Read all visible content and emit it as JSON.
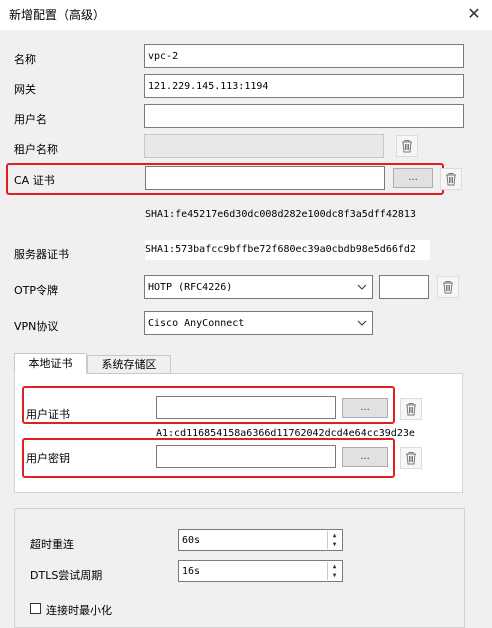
{
  "window": {
    "title": "新增配置（高级）",
    "close_label": "✕"
  },
  "form": {
    "name": {
      "label": "名称",
      "value": "vpc-2"
    },
    "gateway": {
      "label": "网关",
      "value": "121.229.145.113:1194"
    },
    "username": {
      "label": "用户名",
      "value": ""
    },
    "tenant": {
      "label": "租户名称",
      "value": ""
    },
    "ca_cert": {
      "label": "CA 证书",
      "value": "",
      "browse_label": "...",
      "sha1": "SHA1:fe45217e6d30dc008d282e100dc8f3a5dff42813"
    },
    "server_cert": {
      "label": "服务器证书",
      "sha1": "SHA1:573bafcc9bffbe72f680ec39a0cbdb98e5d66fd2"
    },
    "otp": {
      "label": "OTP令牌",
      "selected": "HOTP (RFC4226)",
      "value": ""
    },
    "vpn_protocol": {
      "label": "VPN协议",
      "selected": "Cisco AnyConnect"
    }
  },
  "tabs": [
    {
      "label": "本地证书",
      "active": true
    },
    {
      "label": "系统存储区",
      "active": false
    }
  ],
  "local_cert": {
    "user_cert": {
      "label": "用户证书",
      "value": "",
      "browse_label": "...",
      "sha1_partial": "A1:cd116854158a6366d11762042dcd4e64cc39d23e"
    },
    "user_key": {
      "label": "用户密钥",
      "value": "",
      "browse_label": "..."
    }
  },
  "advanced": {
    "reconnect_timeout": {
      "label": "超时重连",
      "value": "60s"
    },
    "dtls_period": {
      "label": "DTLS尝试周期",
      "value": "16s"
    },
    "minimize_on_connect": {
      "label": "连接时最小化",
      "checked": false
    }
  },
  "colors": {
    "highlight": "#e02020",
    "background": "#f0f0f0"
  }
}
